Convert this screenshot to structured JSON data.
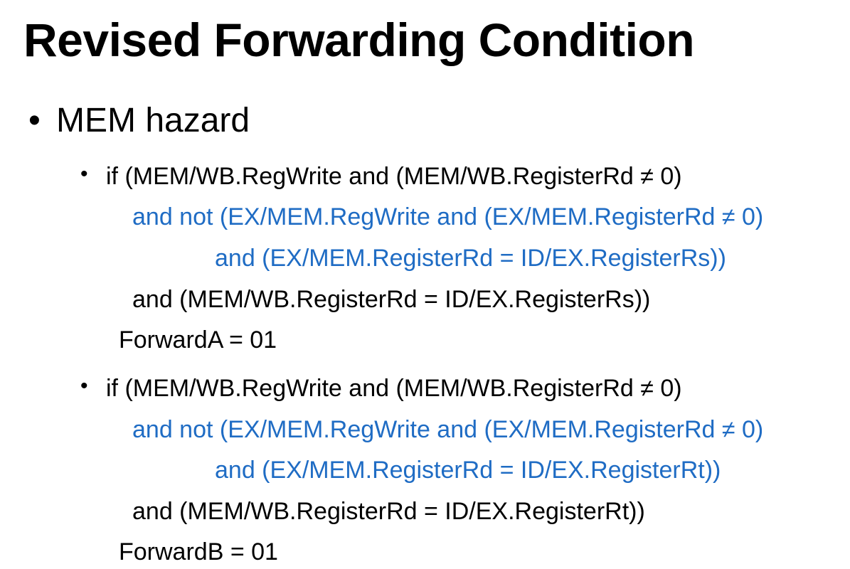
{
  "slide": {
    "title": "Revised Forwarding Condition",
    "section": {
      "bullet_glyph": "•",
      "label": "MEM hazard"
    },
    "conditions": [
      {
        "bullet_glyph": "•",
        "line1": "if (MEM/WB.RegWrite and (MEM/WB.RegisterRd ≠ 0)",
        "line2": "and not (EX/MEM.RegWrite and (EX/MEM.RegisterRd ≠ 0)",
        "line3": "and (EX/MEM.RegisterRd = ID/EX.RegisterRs))",
        "line4": "and (MEM/WB.RegisterRd = ID/EX.RegisterRs))",
        "result": "ForwardA = 01"
      },
      {
        "bullet_glyph": "•",
        "line1": "if (MEM/WB.RegWrite and (MEM/WB.RegisterRd ≠ 0)",
        "line2": "and not (EX/MEM.RegWrite and (EX/MEM.RegisterRd ≠ 0)",
        "line3": "and (EX/MEM.RegisterRd = ID/EX.RegisterRt))",
        "line4": "and (MEM/WB.RegisterRd = ID/EX.RegisterRt))",
        "result": "ForwardB = 01"
      }
    ],
    "colors": {
      "text": "#000000",
      "highlight": "#1f6cc4",
      "background": "#ffffff"
    }
  }
}
